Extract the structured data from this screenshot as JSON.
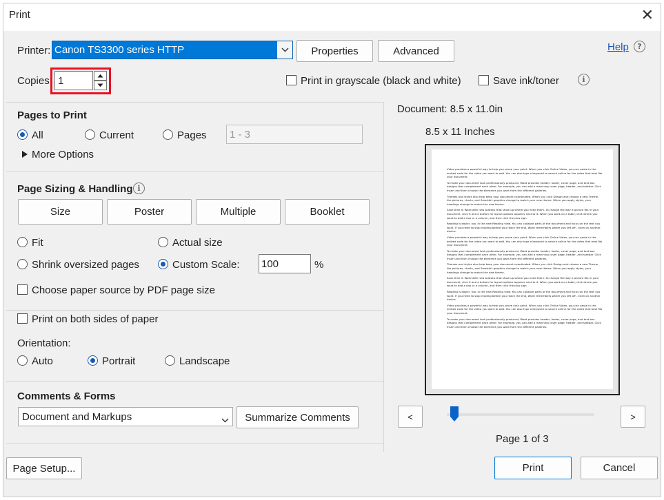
{
  "window": {
    "title": "Print",
    "close_glyph": "✕"
  },
  "top": {
    "printer_label": "Printer:",
    "printer_value": "Canon TS3300 series HTTP",
    "properties_label": "Properties",
    "advanced_label": "Advanced",
    "help_label": "Help",
    "copies_label": "Copies:",
    "copies_value": "1",
    "grayscale_label": "Print in grayscale (black and white)",
    "save_ink_label": "Save ink/toner"
  },
  "pages_to_print": {
    "title": "Pages to Print",
    "all_label": "All",
    "current_label": "Current",
    "pages_label": "Pages",
    "pages_range": "1 - 3",
    "more_options_label": "More Options"
  },
  "sizing": {
    "title": "Page Sizing & Handling",
    "tabs": [
      "Size",
      "Poster",
      "Multiple",
      "Booklet"
    ],
    "fit_label": "Fit",
    "actual_size_label": "Actual size",
    "shrink_label": "Shrink oversized pages",
    "custom_scale_label": "Custom Scale:",
    "custom_scale_value": "100",
    "percent": "%",
    "paper_source_label": "Choose paper source by PDF page size"
  },
  "duplex": {
    "both_sides_label": "Print on both sides of paper",
    "orientation_label": "Orientation:",
    "auto_label": "Auto",
    "portrait_label": "Portrait",
    "landscape_label": "Landscape"
  },
  "comments": {
    "title": "Comments & Forms",
    "selected": "Document and Markups",
    "summarize_label": "Summarize Comments"
  },
  "preview": {
    "document_size": "Document: 8.5 x 11.0in",
    "paper_size": "8.5 x 11 Inches",
    "prev_glyph": "<",
    "next_glyph": ">",
    "page_indicator": "Page 1 of 3",
    "page_progress": 0.0,
    "paragraphs": [
      "Video provides a powerful way to help you prove your point. When you click Online Video, you can paste in the embed code for the video you want to add. You can also type a keyword to search online for the video that best fits your document.",
      "To make your document look professionally produced, Word provides header, footer, cover page, and text box designs that complement each other. For example, you can add a matching cover page, header, and sidebar. Click Insert and then choose the elements you want from the different galleries.",
      "Themes and styles also help keep your document coordinated. When you click Design and choose a new Theme, the pictures, charts, and SmartArt graphics change to match your new theme. When you apply styles, your headings change to match the new theme.",
      "Save time in Word with new buttons that show up where you need them. To change the way a picture fits in your document, click it and a button for layout options appears next to it. When you work on a table, click where you want to add a row or a column, and then click the plus sign.",
      "Reading is easier, too, in the new Reading view. You can collapse parts of the document and focus on the text you want. If you need to stop reading before you reach the end, Word remembers where you left off - even on another device.",
      "Video provides a powerful way to help you prove your point. When you click Online Video, you can paste in the embed code for the video you want to add. You can also type a keyword to search online for the video that best fits your document.",
      "To make your document look professionally produced, Word provides header, footer, cover page, and text box designs that complement each other. For example, you can add a matching cover page, header, and sidebar. Click Insert and then choose the elements you want from the different galleries.",
      "Themes and styles also help keep your document coordinated. When you click Design and choose a new Theme, the pictures, charts, and SmartArt graphics change to match your new theme. When you apply styles, your headings change to match the new theme.",
      "Save time in Word with new buttons that show up where you need them. To change the way a picture fits in your document, click it and a button for layout options appears next to it. When you work on a table, click where you want to add a row or a column, and then click the plus sign.",
      "Reading is easier, too, in the new Reading view. You can collapse parts of the document and focus on the text you want. If you need to stop reading before you reach the end, Word remembers where you left off - even on another device.",
      "Video provides a powerful way to help you prove your point. When you click Online Video, you can paste in the embed code for the video you want to add. You can also type a keyword to search online for the video that best fits your document.",
      "To make your document look professionally produced, Word provides header, footer, cover page, and text box designs that complement each other. For example, you can add a matching cover page, header, and sidebar. Click Insert and then choose the elements you want from the different galleries."
    ]
  },
  "footer": {
    "page_setup_label": "Page Setup...",
    "print_label": "Print",
    "cancel_label": "Cancel"
  },
  "colors": {
    "accent": "#0078d7",
    "highlight": "#e81123",
    "link": "#1a56b8"
  }
}
